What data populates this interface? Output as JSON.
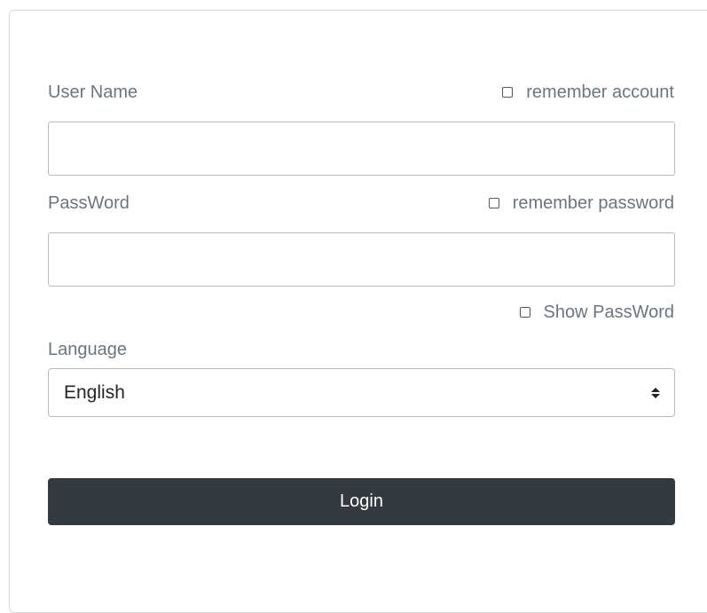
{
  "form": {
    "username_label": "User Name",
    "remember_account_label": "remember account",
    "password_label": "PassWord",
    "remember_password_label": "remember password",
    "show_password_label": "Show PassWord",
    "language_label": "Language",
    "language_value": "English",
    "login_label": "Login",
    "username_value": "",
    "password_value": ""
  },
  "colors": {
    "button_bg": "#343a40",
    "label_text": "#6c757d"
  }
}
